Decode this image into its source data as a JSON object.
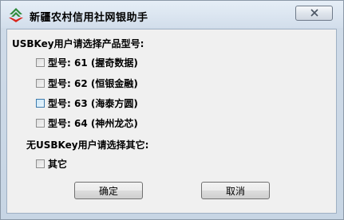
{
  "window": {
    "title": "新疆农村信用社网银助手"
  },
  "usbkey_section": {
    "label": "USBKey用户请选择产品型号:",
    "options": [
      {
        "label": "型号: 61 (握奇数据)",
        "checked": false
      },
      {
        "label": "型号: 62 (恒银金融)",
        "checked": false
      },
      {
        "label": "型号: 63 (海泰方圆)",
        "checked": false,
        "hovered": true
      },
      {
        "label": "型号: 64 (神州龙芯)",
        "checked": false
      }
    ]
  },
  "other_section": {
    "label": "无USBKey用户请选择其它:",
    "option": {
      "label": "其它",
      "checked": false
    }
  },
  "buttons": {
    "ok_label": "确定",
    "cancel_label": "取消"
  },
  "colors": {
    "window_frame": "#c7d5e4",
    "client_background": "#f0f0f0",
    "logo_green": "#2e8b3a",
    "logo_red": "#d9261c"
  }
}
